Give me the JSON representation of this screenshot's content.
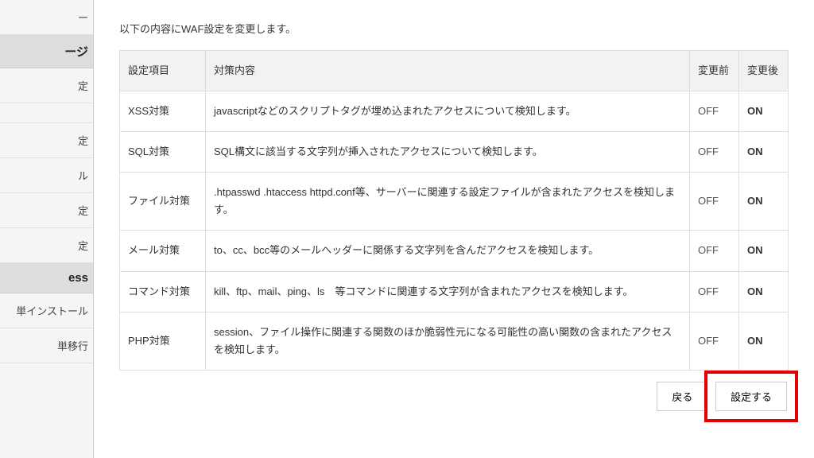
{
  "sidebar": {
    "items": [
      {
        "label": "ー"
      },
      {
        "label": "ージ",
        "heading": true
      },
      {
        "label": "定"
      },
      {
        "label": ""
      },
      {
        "label": "定"
      },
      {
        "label": "ル"
      },
      {
        "label": "定"
      },
      {
        "label": "定"
      },
      {
        "label": "ess",
        "heading": true
      },
      {
        "label": "単インストール"
      },
      {
        "label": "単移行"
      }
    ]
  },
  "main": {
    "intro": "以下の内容にWAF設定を変更します。",
    "headers": {
      "item": "設定項目",
      "desc": "対策内容",
      "before": "変更前",
      "after": "変更後"
    },
    "rows": [
      {
        "item": "XSS対策",
        "desc": "javascriptなどのスクリプトタグが埋め込まれたアクセスについて検知します。",
        "before": "OFF",
        "after": "ON"
      },
      {
        "item": "SQL対策",
        "desc": "SQL構文に該当する文字列が挿入されたアクセスについて検知します。",
        "before": "OFF",
        "after": "ON"
      },
      {
        "item": "ファイル対策",
        "desc": ".htpasswd .htaccess httpd.conf等、サーバーに関連する設定ファイルが含まれたアクセスを検知します。",
        "before": "OFF",
        "after": "ON"
      },
      {
        "item": "メール対策",
        "desc": "to、cc、bcc等のメールヘッダーに関係する文字列を含んだアクセスを検知します。",
        "before": "OFF",
        "after": "ON"
      },
      {
        "item": "コマンド対策",
        "desc": "kill、ftp、mail、ping、ls　等コマンドに関連する文字列が含まれたアクセスを検知します。",
        "before": "OFF",
        "after": "ON"
      },
      {
        "item": "PHP対策",
        "desc": "session、ファイル操作に関連する関数のほか脆弱性元になる可能性の高い関数の含まれたアクセスを検知します。",
        "before": "OFF",
        "after": "ON"
      }
    ],
    "buttons": {
      "back": "戻る",
      "submit": "設定する"
    }
  }
}
